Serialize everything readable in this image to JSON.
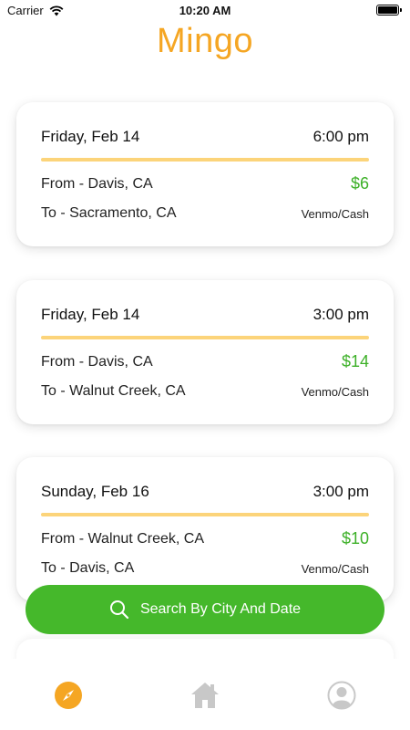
{
  "status_bar": {
    "carrier": "Carrier",
    "time": "10:20 AM"
  },
  "app": {
    "title": "Mingo"
  },
  "rides": [
    {
      "day": "Friday, Feb 14",
      "time": "6:00 pm",
      "from": "From - Davis, CA",
      "to": "To - Sacramento, CA",
      "price": "$6",
      "payment": "Venmo/Cash"
    },
    {
      "day": "Friday, Feb 14",
      "time": "3:00 pm",
      "from": "From - Davis, CA",
      "to": "To - Walnut Creek, CA",
      "price": "$14",
      "payment": "Venmo/Cash"
    },
    {
      "day": "Sunday, Feb 16",
      "time": "3:00 pm",
      "from": "From - Walnut Creek, CA",
      "to": "To - Davis, CA",
      "price": "$10",
      "payment": "Venmo/Cash"
    }
  ],
  "search": {
    "label": "Search By City And Date",
    "icon": "search-icon"
  },
  "tab_bar": {
    "tabs": [
      {
        "name": "explore",
        "icon": "compass-icon",
        "active": true
      },
      {
        "name": "home",
        "icon": "home-icon",
        "active": false
      },
      {
        "name": "profile",
        "icon": "profile-icon",
        "active": false
      }
    ]
  },
  "colors": {
    "brand": "#f5a623",
    "divider": "#fcd47a",
    "price": "#3cb027",
    "button": "#45b82b",
    "tab_inactive": "#c8c8c8"
  }
}
